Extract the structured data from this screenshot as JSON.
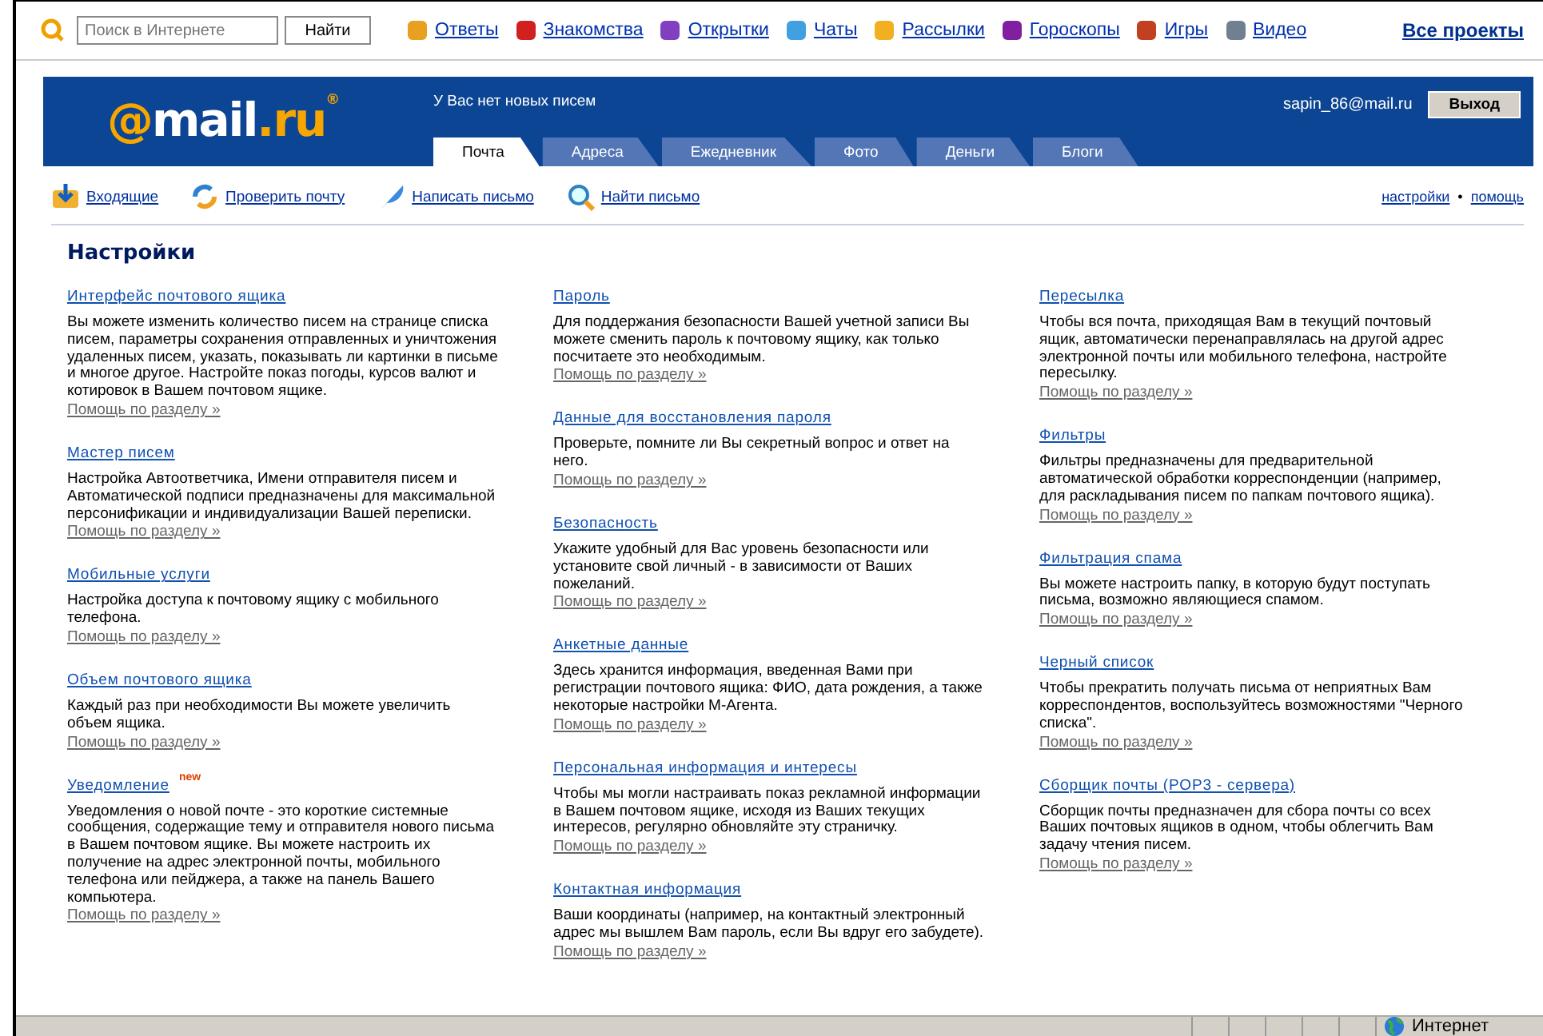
{
  "top_bar": {
    "search": {
      "placeholder": "Поиск в Интернете"
    },
    "search_button": "Найти",
    "projects": [
      "Ответы",
      "Знакомства",
      "Открытки",
      "Чаты",
      "Рассылки",
      "Гороскопы",
      "Игры",
      "Видео"
    ],
    "all_projects": "Все проекты"
  },
  "header": {
    "logo": [
      {
        "text": "@",
        "accent": true
      },
      {
        "text": "mail",
        "accent": false
      },
      {
        "text": ".ru",
        "accent": true
      },
      {
        "text": "®",
        "accent": true
      }
    ],
    "notice": "У Вас нет новых писем",
    "user": "sapin_86@mail.ru",
    "logout": "Выход",
    "tabs": [
      {
        "label": "Почта",
        "selected": true
      },
      {
        "label": "Адреса",
        "selected": false
      },
      {
        "label": "Ежедневник",
        "selected": false
      },
      {
        "label": "Фото",
        "selected": false
      },
      {
        "label": "Деньги",
        "selected": false
      },
      {
        "label": "Блоги",
        "selected": false
      }
    ]
  },
  "toolbar": {
    "actions": [
      "Входящие",
      "Проверить почту",
      "Написать письмо",
      "Найти письмо"
    ],
    "links": [
      "настройки",
      "помощь"
    ],
    "separator": "•"
  },
  "page_title": "Настройки",
  "columns": [
    [
      {
        "title": "Интерфейс почтового ящика",
        "description": "Вы можете изменить количество писем на странице списка писем, параметры сохранения отправленных и уничтожения удаленных писем, указать, показывать ли картинки в письме и многое другое. Настройте показ погоды, курсов валют и котировок в Вашем почтовом ящике.",
        "help": "Помощь по разделу »"
      },
      {
        "title": "Мастер писем",
        "description": "Настройка Автоответчика, Имени отправителя писем и Автоматической подписи предназначены для максимальной персонификации и индивидуализации Вашей переписки.",
        "help": "Помощь по разделу »"
      },
      {
        "title": "Мобильные услуги",
        "description": "Настройка доступа к почтовому ящику с мобильного телефона.",
        "help": "Помощь по разделу »"
      },
      {
        "title": "Объем почтового ящика",
        "description": "Каждый раз при необходимости Вы можете увеличить объем ящика.",
        "help": "Помощь по разделу »"
      },
      {
        "title": "Уведомление",
        "badge": "new",
        "description": "Уведомления о новой почте - это короткие системные сообщения, содержащие тему и отправителя нового письма в Вашем почтовом ящике. Вы можете настроить их получение на адрес электронной почты, мобильного телефона или пейджера, а также на панель Вашего компьютера.",
        "help": "Помощь по разделу »"
      }
    ],
    [
      {
        "title": "Пароль",
        "description": "Для поддержания безопасности Вашей учетной записи Вы можете сменить пароль к почтовому ящику, как только посчитаете это необходимым.",
        "help": "Помощь по разделу »"
      },
      {
        "title": "Данные для восстановления пароля",
        "description": "Проверьте, помните ли Вы секретный вопрос и ответ на него.",
        "help": "Помощь по разделу »"
      },
      {
        "title": "Безопасность",
        "description": "Укажите удобный для Вас уровень безопасности или установите свой личный - в зависимости от Ваших пожеланий.",
        "help": "Помощь по разделу »"
      },
      {
        "title": "Анкетные данные",
        "description": "Здесь хранится информация, введенная Вами при регистрации почтового ящика: ФИО, дата рождения, а также некоторые настройки М-Агента.",
        "help": "Помощь по разделу »"
      },
      {
        "title": "Персональная информация и интересы",
        "description": "Чтобы мы могли настраивать показ рекламной информации в Вашем почтовом ящике, исходя из Ваших текущих интересов, регулярно обновляйте эту страничку.",
        "help": "Помощь по разделу »"
      },
      {
        "title": "Контактная информация",
        "description": "Ваши координаты (например, на контактный электронный адрес мы вышлем Вам пароль, если Вы вдруг его забудете).",
        "help": "Помощь по разделу »"
      }
    ],
    [
      {
        "title": "Пересылка",
        "description": "Чтобы вся почта, приходящая Вам в текущий почтовый ящик, автоматически перенаправлялась на другой адрес электронной почты или мобильного телефона, настройте пересылку.",
        "help": "Помощь по разделу »"
      },
      {
        "title": "Фильтры",
        "description": "Фильтры предназначены для предварительной автоматической обработки корреспонденции (например, для раскладывания писем по папкам почтового ящика).",
        "help": "Помощь по разделу »"
      },
      {
        "title": "Фильтрация спама",
        "description": "Вы можете настроить папку, в которую будут поступать письма, возможно являющиеся спамом.",
        "help": "Помощь по разделу »"
      },
      {
        "title": "Черный список",
        "description": "Чтобы прекратить получать письма от неприятных Вам корреспондентов, воспользуйтесь возможностями \"Черного списка\".",
        "help": "Помощь по разделу »"
      },
      {
        "title": "Сборщик почты (POP3 - сервера)",
        "description": "Сборщик почты предназначен для сбора почты со всех Ваших почтовых ящиков в одном, чтобы облегчить Вам задачу чтения писем.",
        "help": "Помощь по разделу »"
      }
    ]
  ],
  "status_bar": {
    "zone": "Интернет"
  }
}
